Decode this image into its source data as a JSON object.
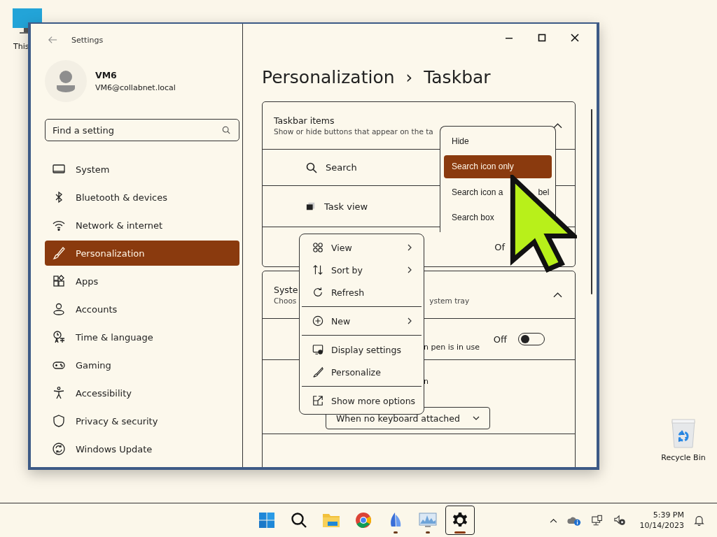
{
  "desktop_icons": [
    {
      "kind": "pc",
      "label": "This"
    },
    {
      "kind": "recycle",
      "label": "Recycle Bin"
    }
  ],
  "window": {
    "title": "Settings"
  },
  "account": {
    "name": "VM6",
    "email": "VM6@collabnet.local"
  },
  "search": {
    "placeholder": "Find a setting"
  },
  "nav": [
    {
      "label": "System",
      "selected": false
    },
    {
      "label": "Bluetooth & devices",
      "selected": false
    },
    {
      "label": "Network & internet",
      "selected": false
    },
    {
      "label": "Personalization",
      "selected": true
    },
    {
      "label": "Apps",
      "selected": false
    },
    {
      "label": "Accounts",
      "selected": false
    },
    {
      "label": "Time & language",
      "selected": false
    },
    {
      "label": "Gaming",
      "selected": false
    },
    {
      "label": "Accessibility",
      "selected": false
    },
    {
      "label": "Privacy & security",
      "selected": false
    },
    {
      "label": "Windows Update",
      "selected": false
    }
  ],
  "breadcrumb": {
    "parent": "Personalization",
    "separator": "›",
    "current": "Taskbar"
  },
  "cards": [
    {
      "title": "Taskbar items",
      "subtitle": [
        "Show or hide buttons that appear on the ta"
      ],
      "expanded": true,
      "rows": [
        {
          "kind": "item",
          "label": "Search"
        },
        {
          "kind": "item",
          "label": "Task view"
        },
        {
          "kind": "state",
          "value": "Of"
        }
      ]
    },
    {
      "title": "Syste",
      "subtitle": [
        "Choos",
        "ystem tray"
      ],
      "expanded": true,
      "rows": [
        {
          "kind": "toggle",
          "description": "n pen is in use",
          "value": "Off",
          "on": false
        },
        {
          "kind": "combo",
          "label": "n",
          "value": "When no keyboard attached"
        },
        {
          "kind": "empty"
        }
      ]
    }
  ],
  "dropdown": {
    "options": [
      {
        "parts": [
          "Hide"
        ],
        "selected": false
      },
      {
        "parts": [
          "Search icon only"
        ],
        "selected": true
      },
      {
        "parts": [
          "Search icon a",
          "bel"
        ],
        "selected": false
      },
      {
        "parts": [
          "Search box"
        ],
        "selected": false
      }
    ]
  },
  "context_menu": {
    "items": [
      {
        "kind": "item",
        "label": "View",
        "submenu": true
      },
      {
        "kind": "item",
        "label": "Sort by",
        "submenu": true
      },
      {
        "kind": "item",
        "label": "Refresh",
        "submenu": false
      },
      {
        "kind": "separator"
      },
      {
        "kind": "item",
        "label": "New",
        "submenu": true
      },
      {
        "kind": "separator"
      },
      {
        "kind": "item",
        "label": "Display settings",
        "submenu": false
      },
      {
        "kind": "item",
        "label": "Personalize",
        "submenu": false
      },
      {
        "kind": "separator"
      },
      {
        "kind": "item",
        "label": "Show more options",
        "submenu": false
      }
    ]
  },
  "taskbar": {
    "apps": [
      {
        "running": false,
        "active": false
      },
      {
        "running": false,
        "active": false
      },
      {
        "running": false,
        "active": false
      },
      {
        "running": false,
        "active": false
      },
      {
        "running": true,
        "active": false
      },
      {
        "running": true,
        "active": false
      },
      {
        "running": true,
        "active": true
      }
    ],
    "time": "5:39 PM",
    "date": "10/14/2023"
  }
}
